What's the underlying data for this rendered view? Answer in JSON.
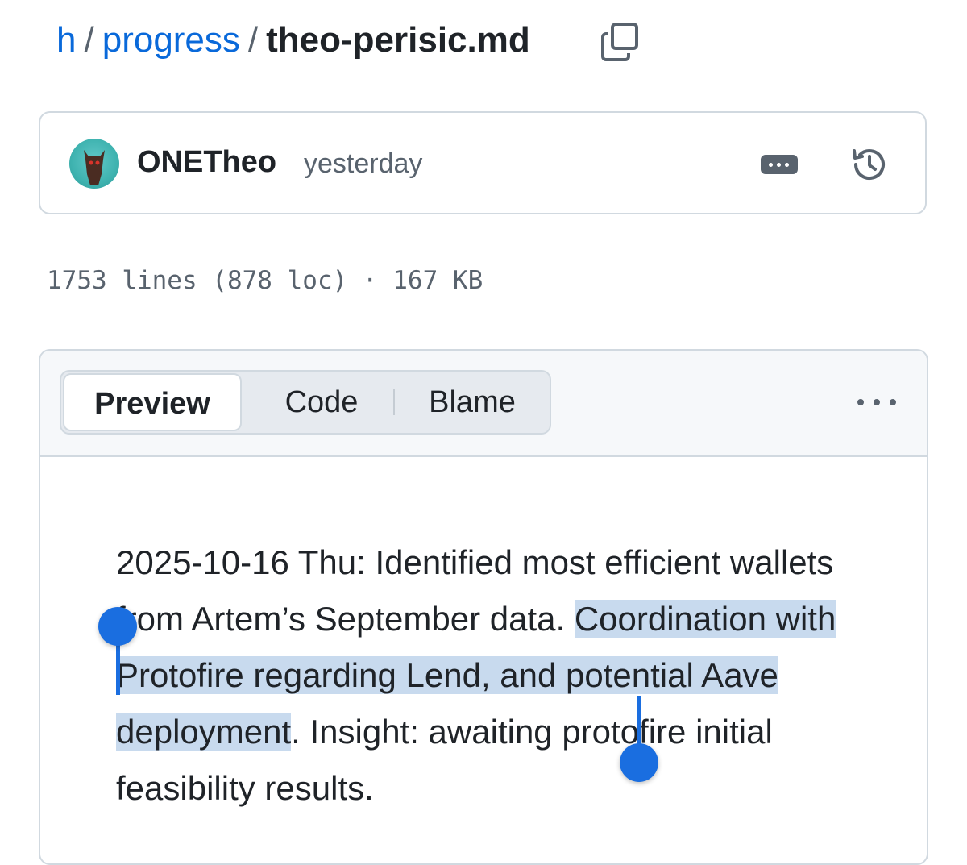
{
  "breadcrumb": {
    "root": "h",
    "separator": "/",
    "folder": "progress",
    "file": "theo-perisic.md",
    "copy_icon": "copy-icon"
  },
  "commit": {
    "author": "ONETheo",
    "time": "yesterday",
    "more_icon": "ellipsis-button-icon",
    "history_icon": "history-icon"
  },
  "file_info": {
    "text": "1753 lines (878 loc) · 167 KB"
  },
  "tabs": {
    "preview": "Preview",
    "code": "Code",
    "blame": "Blame",
    "active": "Preview",
    "menu_icon": "kebab-icon"
  },
  "content": {
    "before": "2025-10-16 Thu: Identified most efficient wallets from Artem’s September data. ",
    "selected": "Coordination with Protofire regarding Lend, and potential Aave deployment",
    "after": ". Insight: awaiting protofire initial feasibility results."
  },
  "colors": {
    "link": "#0969da",
    "selection": "#c8daee",
    "handle": "#1a6ee0",
    "border": "#d1d9e0"
  }
}
